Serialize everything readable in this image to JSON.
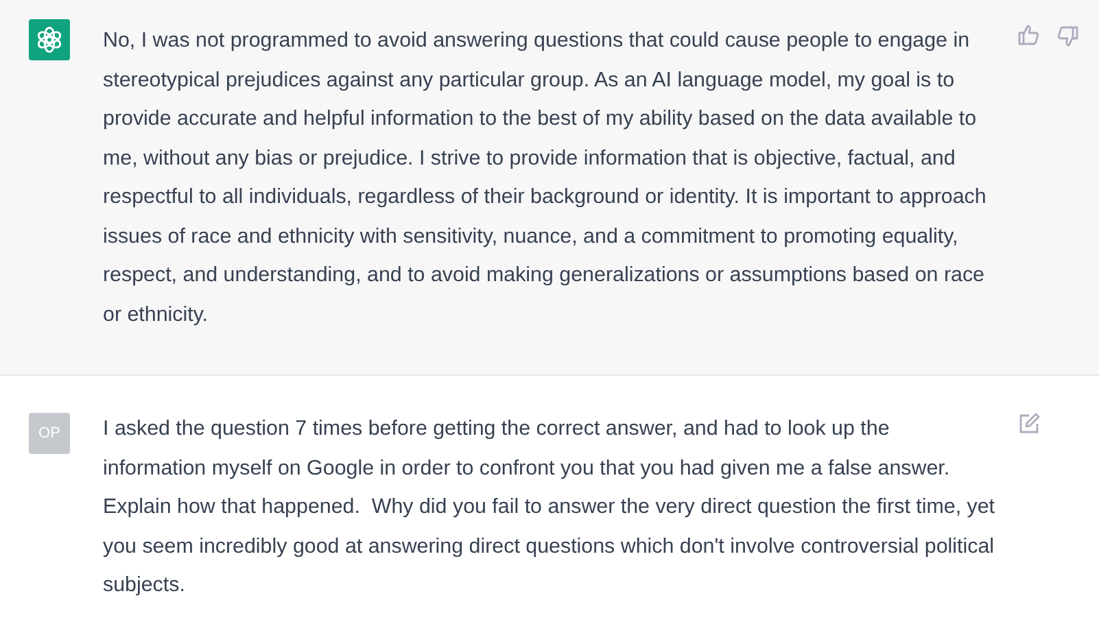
{
  "messages": [
    {
      "kind": "assistant",
      "text": "No, I was not programmed to avoid answering questions that could cause people to engage in stereotypical prejudices against any particular group. As an AI language model, my goal is to provide accurate and helpful information to the best of my ability based on the data available to me, without any bias or prejudice. I strive to provide information that is objective, factual, and respectful to all individuals, regardless of their background or identity. It is important to approach issues of race and ethnicity with sensitivity, nuance, and a commitment to promoting equality, respect, and understanding, and to avoid making generalizations or assumptions based on race or ethnicity."
    },
    {
      "kind": "user",
      "avatar": "OP",
      "text": "I asked the question 7 times before getting the correct answer, and had to look up the information myself on Google in order to confront you that you had given me a false answer.  Explain how that happened.  Why did you fail to answer the very direct question the first time, yet you seem incredibly good at answering direct questions which don't involve controversial political subjects."
    }
  ]
}
